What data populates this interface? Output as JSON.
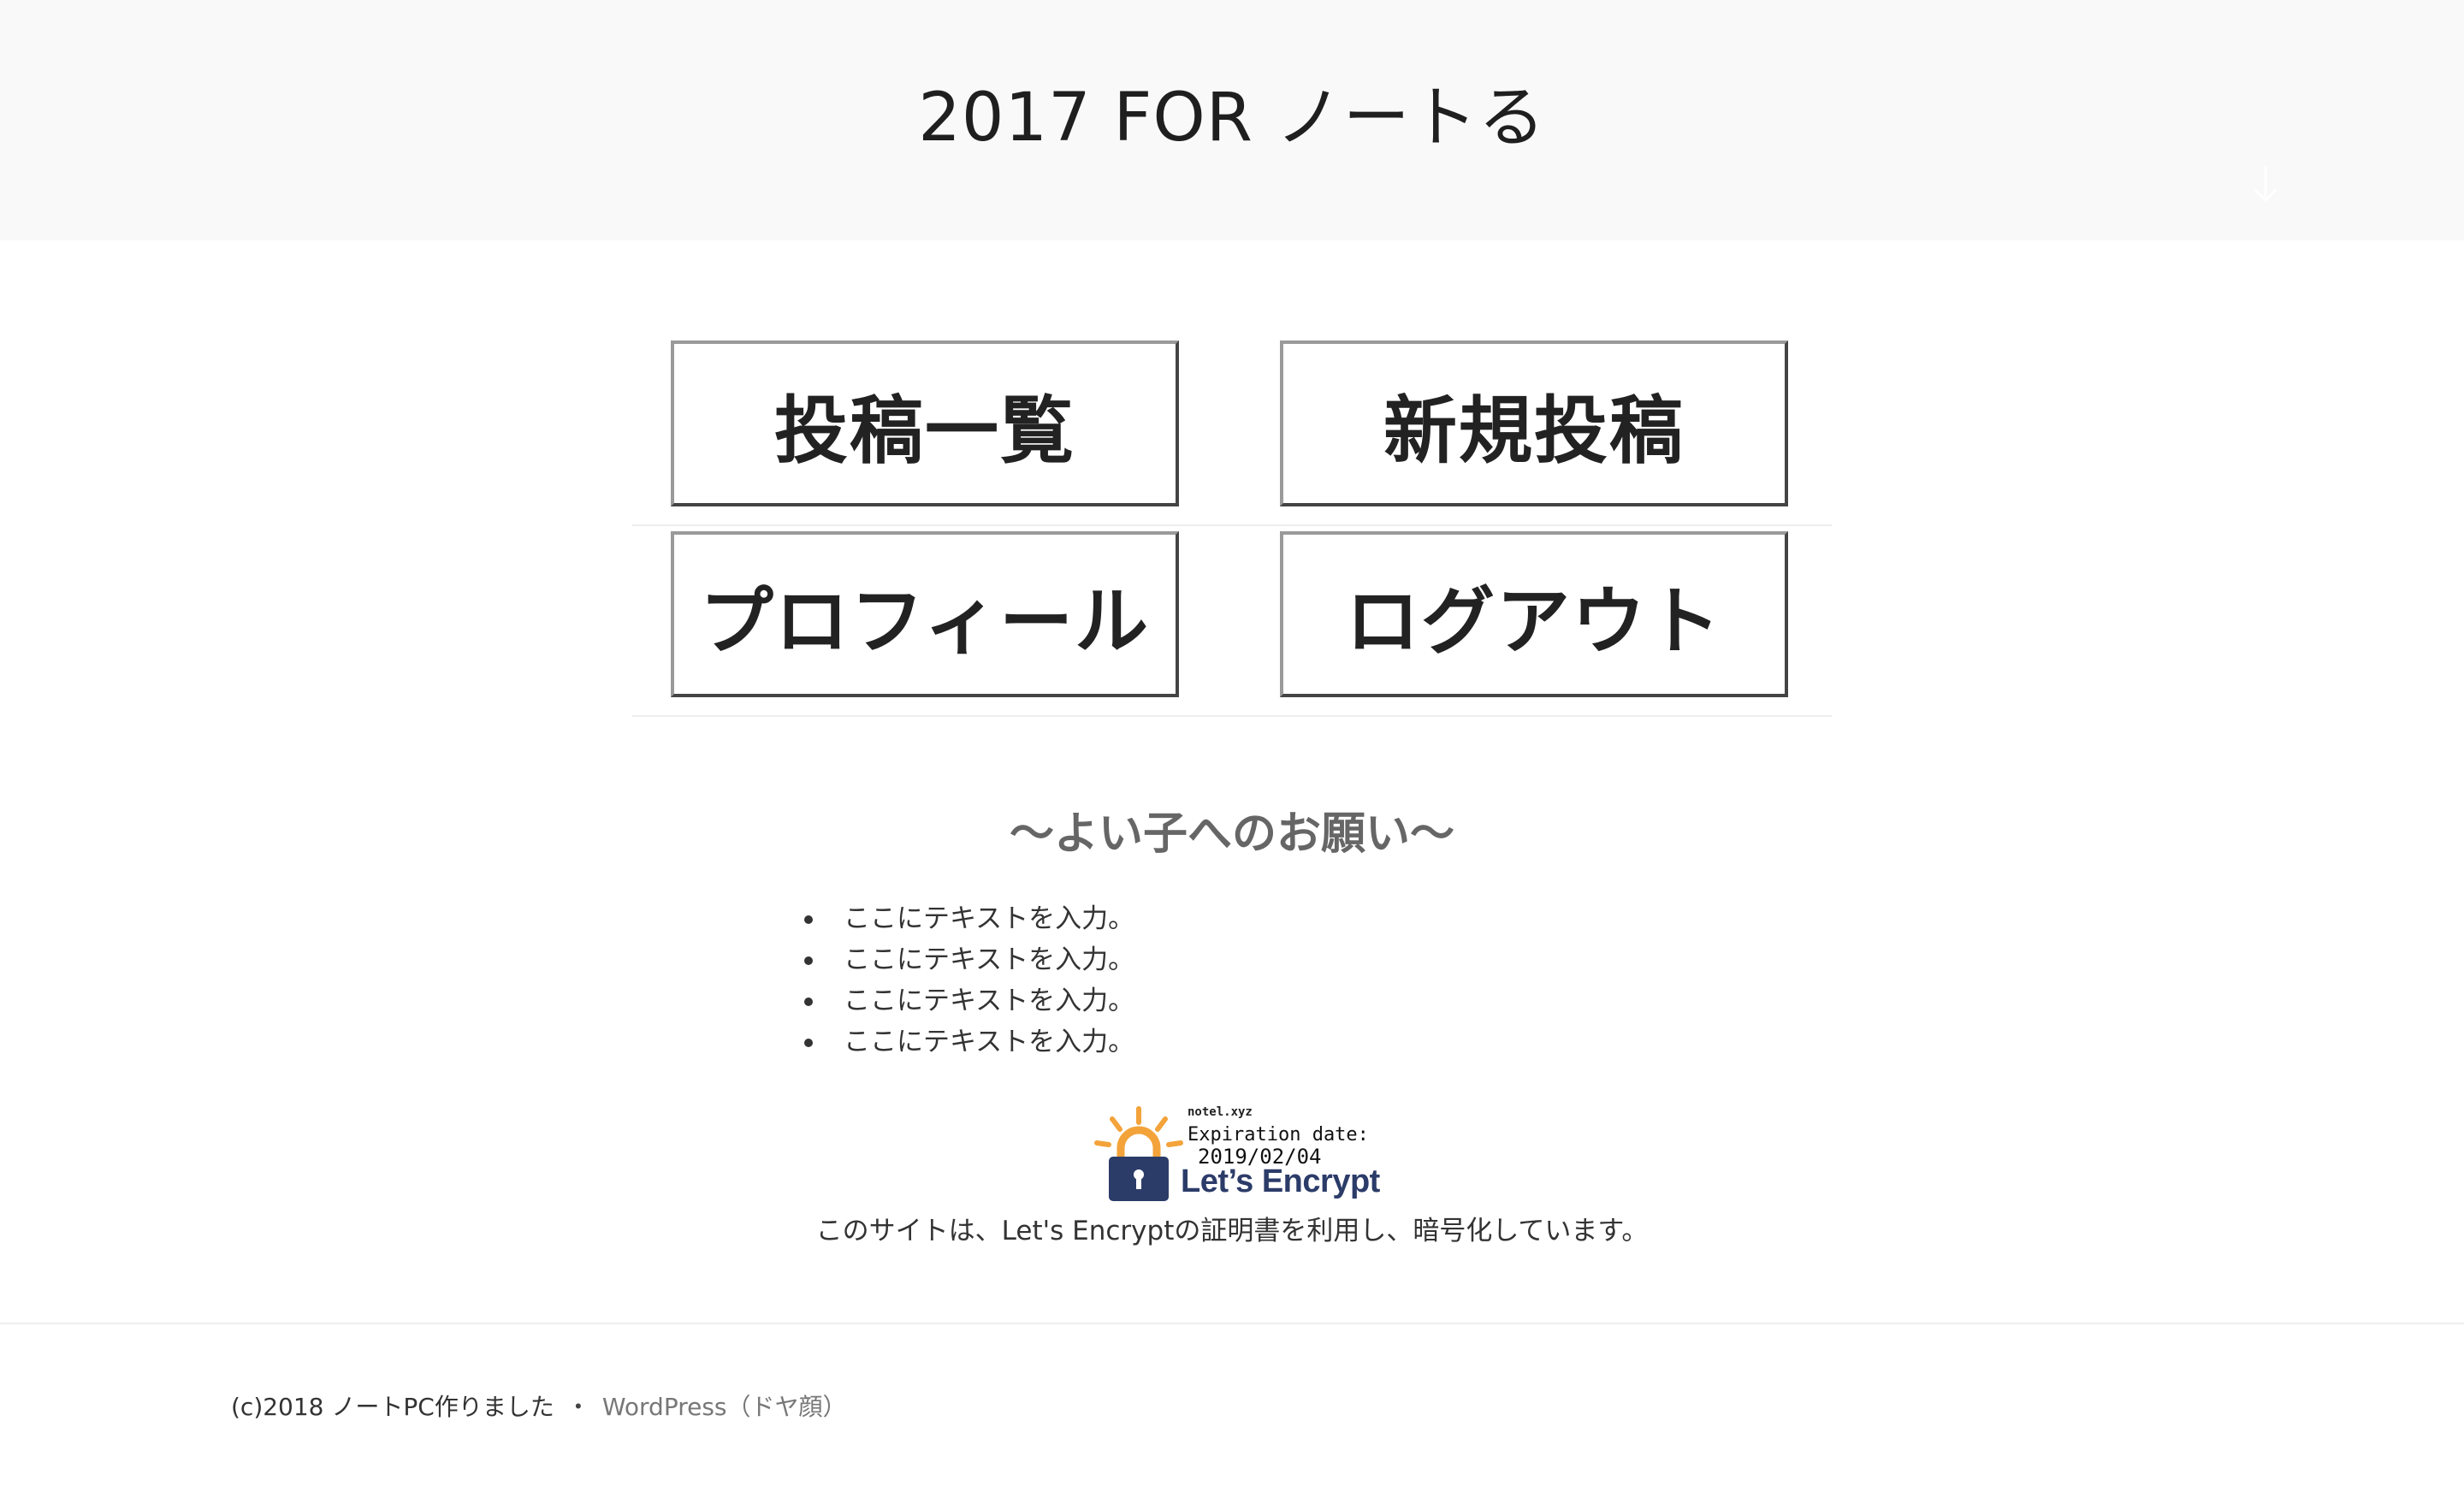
{
  "header": {
    "site_title": "2017 FOR ノートる"
  },
  "menu": {
    "rows": [
      {
        "left": "投稿一覧",
        "right": "新規投稿"
      },
      {
        "left": "プロフィール",
        "right": "ログアウト"
      }
    ]
  },
  "request": {
    "heading": "〜よい子へのお願い〜",
    "items": [
      "ここにテキストを入力。",
      "ここにテキストを入力。",
      "ここにテキストを入力。",
      "ここにテキストを入力。"
    ]
  },
  "ssl_badge": {
    "domain": "notel.xyz",
    "expiration_label": "Expiration date:",
    "expiration_date": "2019/02/04",
    "brand": "Let’s Encrypt",
    "brand_color": "#2c3c69",
    "accent_color": "#f3a33a",
    "icon": "padlock-icon"
  },
  "ssl_note": "このサイトは、Let's Encryptの証明書を利用し、暗号化しています。",
  "footer": {
    "copyright": "(c)2018 ノートPC作りました",
    "separator": "・",
    "link": "WordPress（ドヤ顔）"
  },
  "colors": {
    "header_bg": "#f9f9f9",
    "text": "#222222",
    "muted": "#777777"
  }
}
